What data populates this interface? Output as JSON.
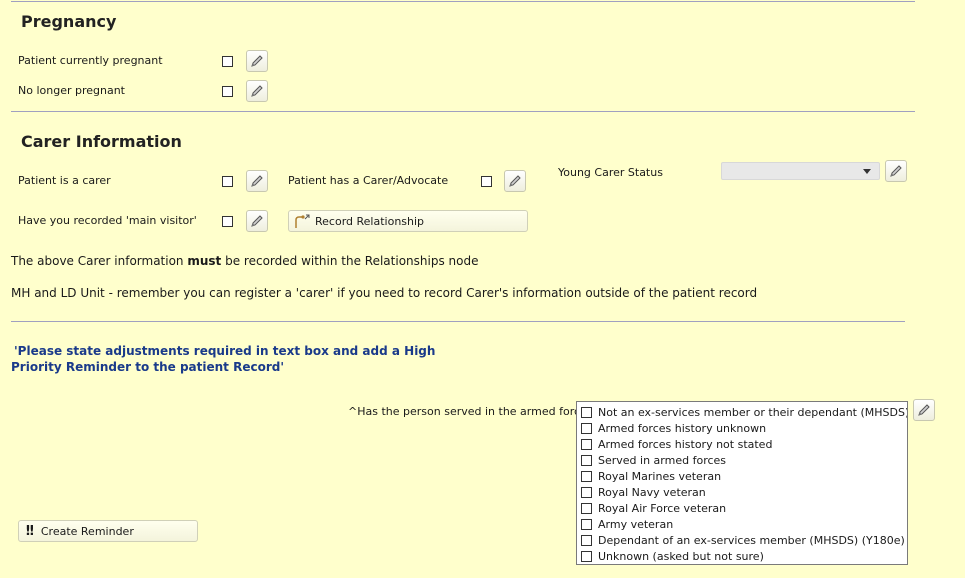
{
  "pregnancy": {
    "title": "Pregnancy",
    "currently_pregnant_label": "Patient currently pregnant",
    "no_longer_pregnant_label": "No longer pregnant"
  },
  "carer": {
    "title": "Carer Information",
    "is_carer_label": "Patient is a carer",
    "has_carer_label": "Patient has a Carer/Advocate",
    "young_carer_label": "Young Carer Status",
    "young_carer_value": "",
    "main_visitor_label": "Have you recorded 'main visitor'",
    "record_relationship_label": "Record Relationship"
  },
  "notes": {
    "carer_prefix": "The above Carer information ",
    "carer_bold": "must",
    "carer_suffix": " be recorded within the Relationships node",
    "mh_ld": "MH and LD Unit - remember you can register a 'carer' if you need to record Carer's information outside of the patient record",
    "adjustments_line1": "'Please state adjustments required in text box and add a High",
    "adjustments_line2": "Priority Reminder to the patient Record'"
  },
  "armed_forces": {
    "question": "^Has the person served in the armed forces?",
    "options": [
      "Not an ex-services member or their dependant (MHSDS) (...",
      "Armed forces history unknown",
      "Armed forces history not stated",
      "Served in armed forces",
      "Royal Marines veteran",
      "Royal Navy veteran",
      "Royal Air Force veteran",
      "Army veteran",
      "Dependant of an ex-services member (MHSDS) (Y180e)",
      "Unknown (asked but not sure)"
    ]
  },
  "reminder": {
    "icon_text": "!!",
    "label": "Create Reminder"
  }
}
